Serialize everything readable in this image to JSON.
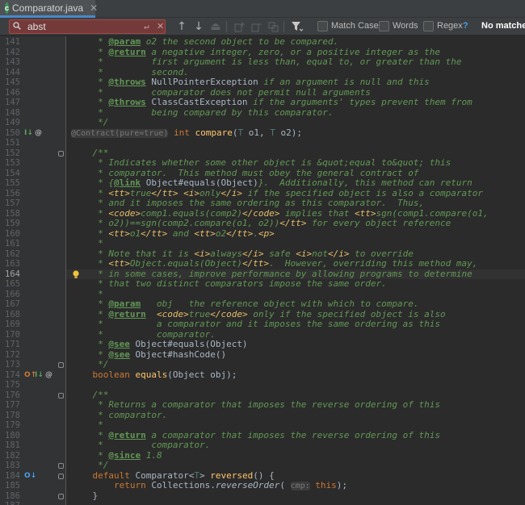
{
  "tab": {
    "icon_letter": "c",
    "label": "Comparator.java",
    "close": "✕"
  },
  "search": {
    "query": "abst",
    "enter_glyph": "↵",
    "clear_glyph": "✕",
    "prev": "↑",
    "next": "↓",
    "find_all": "⏏",
    "options": [
      {
        "label": "Match Case"
      },
      {
        "label": "Words"
      },
      {
        "label": "Regex"
      }
    ],
    "help": "?",
    "status": "No matches"
  },
  "editor": {
    "current_line": 164,
    "lines": [
      {
        "n": 141,
        "tokens": [
          [
            "doc",
            "     * "
          ],
          [
            "tag",
            "@param"
          ],
          [
            "doc",
            " o2 the second object to be compared."
          ]
        ]
      },
      {
        "n": 142,
        "tokens": [
          [
            "doc",
            "     * "
          ],
          [
            "tag",
            "@return"
          ],
          [
            "doc",
            " a negative integer, zero, or a positive integer as the"
          ]
        ]
      },
      {
        "n": 143,
        "tokens": [
          [
            "doc",
            "     *         first argument is less than, equal to, or greater than the"
          ]
        ]
      },
      {
        "n": 144,
        "tokens": [
          [
            "doc",
            "     *         second."
          ]
        ]
      },
      {
        "n": 145,
        "tokens": [
          [
            "doc",
            "     * "
          ],
          [
            "tag",
            "@throws"
          ],
          [
            "doc",
            " "
          ],
          [
            "plain",
            "NullPointerException"
          ],
          [
            "doc",
            " if an argument is null and this"
          ]
        ]
      },
      {
        "n": 146,
        "tokens": [
          [
            "doc",
            "     *         comparator does not permit null arguments"
          ]
        ]
      },
      {
        "n": 147,
        "tokens": [
          [
            "doc",
            "     * "
          ],
          [
            "tag",
            "@throws"
          ],
          [
            "doc",
            " "
          ],
          [
            "plain",
            "ClassCastException"
          ],
          [
            "doc",
            " if the arguments' types prevent them from"
          ]
        ]
      },
      {
        "n": 148,
        "tokens": [
          [
            "doc",
            "     *         being compared by this comparator."
          ]
        ]
      },
      {
        "n": 149,
        "tokens": [
          [
            "doc",
            "     */"
          ]
        ]
      },
      {
        "n": 150,
        "tokens": [
          [
            "hint",
            "@Contract(pure=true)"
          ],
          [
            "plain",
            " "
          ],
          [
            "kw",
            "int "
          ],
          [
            "fn",
            "compare"
          ],
          [
            "plain",
            "("
          ],
          [
            "tp",
            "T"
          ],
          [
            "plain",
            " o1, "
          ],
          [
            "tp",
            "T"
          ],
          [
            "plain",
            " o2);"
          ]
        ]
      },
      {
        "n": 151,
        "tokens": []
      },
      {
        "n": 152,
        "tokens": [
          [
            "doc",
            "    /**"
          ]
        ]
      },
      {
        "n": 153,
        "tokens": [
          [
            "doc",
            "     * Indicates whether some other object is &quot;equal to&quot; this"
          ]
        ]
      },
      {
        "n": 154,
        "tokens": [
          [
            "doc",
            "     * comparator.  This method must obey the general contract of"
          ]
        ]
      },
      {
        "n": 155,
        "tokens": [
          [
            "doc",
            "     * {"
          ],
          [
            "tag",
            "@link"
          ],
          [
            "doc",
            " "
          ],
          [
            "plain",
            "Object#equals(Object)"
          ],
          [
            "doc",
            "}.  Additionally, this method can return"
          ]
        ]
      },
      {
        "n": 156,
        "tokens": [
          [
            "doc",
            "     * "
          ],
          [
            "html",
            "<tt>"
          ],
          [
            "doc",
            "true"
          ],
          [
            "html",
            "</tt>"
          ],
          [
            "doc",
            " "
          ],
          [
            "html",
            "<i>"
          ],
          [
            "doc",
            "only"
          ],
          [
            "html",
            "</i>"
          ],
          [
            "doc",
            " if the specified object is also a comparator"
          ]
        ]
      },
      {
        "n": 157,
        "tokens": [
          [
            "doc",
            "     * and it imposes the same ordering as this comparator.  Thus,"
          ]
        ]
      },
      {
        "n": 158,
        "tokens": [
          [
            "doc",
            "     * "
          ],
          [
            "html",
            "<code>"
          ],
          [
            "doc",
            "comp1.equals(comp2)"
          ],
          [
            "html",
            "</code>"
          ],
          [
            "doc",
            " implies that "
          ],
          [
            "html",
            "<tt>"
          ],
          [
            "doc",
            "sgn(comp1.compare(o1,"
          ]
        ]
      },
      {
        "n": 159,
        "tokens": [
          [
            "doc",
            "     * o2))==sgn(comp2.compare(o1, o2))"
          ],
          [
            "html",
            "</tt>"
          ],
          [
            "doc",
            " for every object reference"
          ]
        ]
      },
      {
        "n": 160,
        "tokens": [
          [
            "doc",
            "     * "
          ],
          [
            "html",
            "<tt>"
          ],
          [
            "doc",
            "o1"
          ],
          [
            "html",
            "</tt>"
          ],
          [
            "doc",
            " and "
          ],
          [
            "html",
            "<tt>"
          ],
          [
            "doc",
            "o2"
          ],
          [
            "html",
            "</tt>"
          ],
          [
            "doc",
            "."
          ],
          [
            "html",
            "<p>"
          ]
        ]
      },
      {
        "n": 161,
        "tokens": [
          [
            "doc",
            "     *"
          ]
        ]
      },
      {
        "n": 162,
        "tokens": [
          [
            "doc",
            "     * Note that it is "
          ],
          [
            "html",
            "<i>"
          ],
          [
            "doc",
            "always"
          ],
          [
            "html",
            "</i>"
          ],
          [
            "doc",
            " safe "
          ],
          [
            "html",
            "<i>"
          ],
          [
            "doc",
            "not"
          ],
          [
            "html",
            "</i>"
          ],
          [
            "doc",
            " to override"
          ]
        ]
      },
      {
        "n": 163,
        "tokens": [
          [
            "doc",
            "     * "
          ],
          [
            "html",
            "<tt>"
          ],
          [
            "doc",
            "Object.equals(Object)"
          ],
          [
            "html",
            "</tt>"
          ],
          [
            "doc",
            ".  However, overriding this method may,"
          ]
        ]
      },
      {
        "n": 164,
        "tokens": [
          [
            "doc",
            "     * in some cases, improve performance by allowing programs to determine"
          ]
        ]
      },
      {
        "n": 165,
        "tokens": [
          [
            "doc",
            "     * that two distinct comparators impose the same order."
          ]
        ]
      },
      {
        "n": 166,
        "tokens": [
          [
            "doc",
            "     *"
          ]
        ]
      },
      {
        "n": 167,
        "tokens": [
          [
            "doc",
            "     * "
          ],
          [
            "tag",
            "@param"
          ],
          [
            "doc",
            "   obj   the reference object with which to compare."
          ]
        ]
      },
      {
        "n": 168,
        "tokens": [
          [
            "doc",
            "     * "
          ],
          [
            "tag",
            "@return"
          ],
          [
            "doc",
            "  "
          ],
          [
            "html",
            "<code>"
          ],
          [
            "doc",
            "true"
          ],
          [
            "html",
            "</code>"
          ],
          [
            "doc",
            " only if the specified object is also"
          ]
        ]
      },
      {
        "n": 169,
        "tokens": [
          [
            "doc",
            "     *          a comparator and it imposes the same ordering as this"
          ]
        ]
      },
      {
        "n": 170,
        "tokens": [
          [
            "doc",
            "     *          comparator."
          ]
        ]
      },
      {
        "n": 171,
        "tokens": [
          [
            "doc",
            "     * "
          ],
          [
            "tag",
            "@see"
          ],
          [
            "doc",
            " "
          ],
          [
            "plain",
            "Object#equals(Object)"
          ]
        ]
      },
      {
        "n": 172,
        "tokens": [
          [
            "doc",
            "     * "
          ],
          [
            "tag",
            "@see"
          ],
          [
            "doc",
            " "
          ],
          [
            "plain",
            "Object#hashCode()"
          ]
        ]
      },
      {
        "n": 173,
        "tokens": [
          [
            "doc",
            "     */"
          ]
        ]
      },
      {
        "n": 174,
        "tokens": [
          [
            "kw",
            "    boolean "
          ],
          [
            "fn",
            "equals"
          ],
          [
            "plain",
            "(Object obj);"
          ]
        ]
      },
      {
        "n": 175,
        "tokens": []
      },
      {
        "n": 176,
        "tokens": [
          [
            "doc",
            "    /**"
          ]
        ]
      },
      {
        "n": 177,
        "tokens": [
          [
            "doc",
            "     * Returns a comparator that imposes the reverse ordering of this"
          ]
        ]
      },
      {
        "n": 178,
        "tokens": [
          [
            "doc",
            "     * comparator."
          ]
        ]
      },
      {
        "n": 179,
        "tokens": [
          [
            "doc",
            "     *"
          ]
        ]
      },
      {
        "n": 180,
        "tokens": [
          [
            "doc",
            "     * "
          ],
          [
            "tag",
            "@return"
          ],
          [
            "doc",
            " a comparator that imposes the reverse ordering of this"
          ]
        ]
      },
      {
        "n": 181,
        "tokens": [
          [
            "doc",
            "     *         comparator."
          ]
        ]
      },
      {
        "n": 182,
        "tokens": [
          [
            "doc",
            "     * "
          ],
          [
            "tag",
            "@since"
          ],
          [
            "doc",
            " 1.8"
          ]
        ]
      },
      {
        "n": 183,
        "tokens": [
          [
            "doc",
            "     */"
          ]
        ]
      },
      {
        "n": 184,
        "tokens": [
          [
            "kw",
            "    default "
          ],
          [
            "plain",
            "Comparator<"
          ],
          [
            "tp",
            "T"
          ],
          [
            "plain",
            "> "
          ],
          [
            "fn",
            "reversed"
          ],
          [
            "plain",
            "() {"
          ]
        ]
      },
      {
        "n": 185,
        "tokens": [
          [
            "kw",
            "        return "
          ],
          [
            "plain",
            "Collections."
          ],
          [
            "fnit",
            "reverseOrder"
          ],
          [
            "plain",
            "( "
          ],
          [
            "hint",
            "cmp:"
          ],
          [
            "plain",
            " "
          ],
          [
            "kw",
            "this"
          ],
          [
            "plain",
            ");"
          ]
        ]
      },
      {
        "n": 186,
        "tokens": [
          [
            "plain",
            "    }"
          ]
        ]
      },
      {
        "n": 187,
        "tokens": []
      },
      {
        "n": 188,
        "tokens": [
          [
            "doc",
            "    /**"
          ]
        ]
      }
    ],
    "gutter_marks": [
      {
        "line": 150,
        "marks": [
          "implemented-down-icon",
          "override-at-icon"
        ]
      },
      {
        "line": 164,
        "marks": [
          "intention-bulb-icon"
        ]
      },
      {
        "line": 174,
        "marks": [
          "overriding-up-icon",
          "implemented-down-icon",
          "override-at-icon"
        ]
      },
      {
        "line": 184,
        "marks": [
          "overridden-circle-icon"
        ]
      }
    ]
  }
}
